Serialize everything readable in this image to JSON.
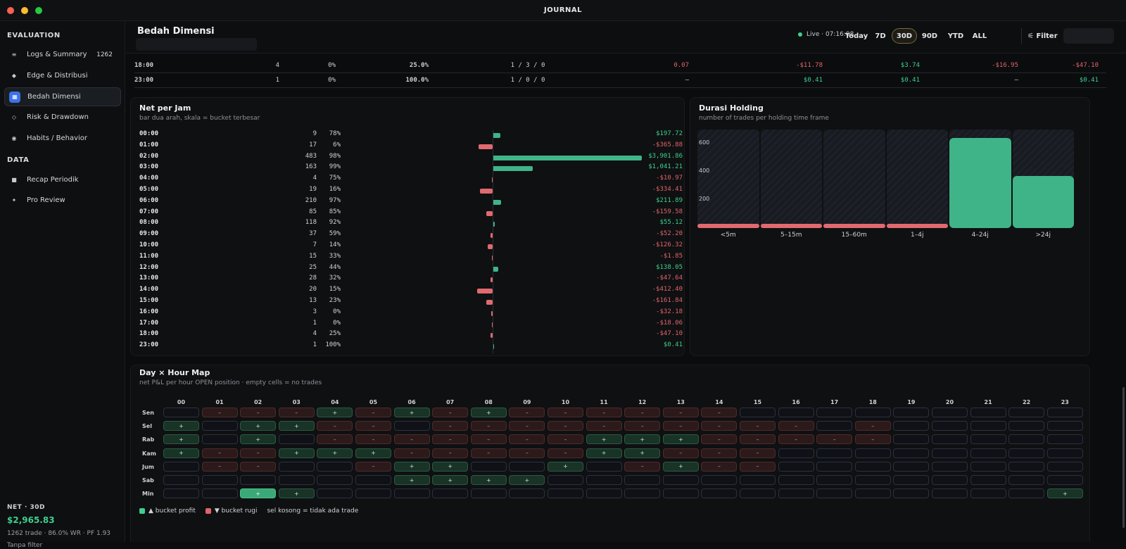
{
  "app": {
    "title": "JOURNAL"
  },
  "sidebar": {
    "sections": [
      {
        "title": "EVALUATION",
        "items": [
          {
            "label": "Logs & Summary",
            "badge": "1262",
            "icon": "list-icon",
            "glyph": "≡"
          },
          {
            "label": "Edge & Distribusi",
            "icon": "diamond-icon",
            "glyph": "◆"
          },
          {
            "label": "Bedah Dimensi",
            "icon": "grid-icon",
            "glyph": "▦",
            "active": true
          },
          {
            "label": "Risk & Drawdown",
            "icon": "circle-icon",
            "glyph": "◇"
          },
          {
            "label": "Habits / Behavior",
            "icon": "dot-icon",
            "glyph": "◉"
          }
        ]
      },
      {
        "title": "DATA",
        "items": [
          {
            "label": "Recap Periodik",
            "icon": "square-icon",
            "glyph": "■"
          },
          {
            "label": "Pro Review",
            "icon": "star-icon",
            "glyph": "✦"
          }
        ]
      }
    ],
    "footer": {
      "label": "NET · 30D",
      "value": "$2,965.83",
      "stats": "1262 trade · 86.0% WR · PF 1.93",
      "filter": "Tanpa filter"
    }
  },
  "header": {
    "title": "Bedah Dimensi",
    "live": "Live · 07:16:08",
    "ranges": [
      "Today",
      "7D",
      "30D",
      "90D",
      "YTD",
      "ALL"
    ],
    "active_range": "30D",
    "filter_label": "⚟ Filter"
  },
  "top_table": {
    "rows": [
      [
        "18:00",
        "4",
        "0%",
        "25.0%",
        "1 / 3 / 0",
        "0.07",
        "-$11.78",
        "$3.74",
        "-$16.95",
        "-$47.10"
      ],
      [
        "23:00",
        "1",
        "0%",
        "100.0%",
        "1 / 0 / 0",
        "–",
        "$0.41",
        "$0.41",
        "–",
        "$0.41"
      ]
    ]
  },
  "net_per_jam": {
    "title": "Net per Jam",
    "subtitle": "bar dua arah, skala = bucket terbesar",
    "rows": [
      {
        "hour": "00:00",
        "count": "9",
        "wr": "78%",
        "value": 197.72,
        "label": "$197.72"
      },
      {
        "hour": "01:00",
        "count": "17",
        "wr": "6%",
        "value": -365.88,
        "label": "-$365.88"
      },
      {
        "hour": "02:00",
        "count": "483",
        "wr": "98%",
        "value": 3901.86,
        "label": "$3,901.86"
      },
      {
        "hour": "03:00",
        "count": "163",
        "wr": "99%",
        "value": 1041.21,
        "label": "$1,041.21"
      },
      {
        "hour": "04:00",
        "count": "4",
        "wr": "75%",
        "value": -10.97,
        "label": "-$10.97"
      },
      {
        "hour": "05:00",
        "count": "19",
        "wr": "16%",
        "value": -334.41,
        "label": "-$334.41"
      },
      {
        "hour": "06:00",
        "count": "210",
        "wr": "97%",
        "value": 211.89,
        "label": "$211.89"
      },
      {
        "hour": "07:00",
        "count": "85",
        "wr": "85%",
        "value": -159.58,
        "label": "-$159.58"
      },
      {
        "hour": "08:00",
        "count": "118",
        "wr": "92%",
        "value": 55.12,
        "label": "$55.12"
      },
      {
        "hour": "09:00",
        "count": "37",
        "wr": "59%",
        "value": -52.2,
        "label": "-$52.20"
      },
      {
        "hour": "10:00",
        "count": "7",
        "wr": "14%",
        "value": -126.32,
        "label": "-$126.32"
      },
      {
        "hour": "11:00",
        "count": "15",
        "wr": "33%",
        "value": -1.85,
        "label": "-$1.85"
      },
      {
        "hour": "12:00",
        "count": "25",
        "wr": "44%",
        "value": 138.05,
        "label": "$138.05"
      },
      {
        "hour": "13:00",
        "count": "28",
        "wr": "32%",
        "value": -47.64,
        "label": "-$47.64"
      },
      {
        "hour": "14:00",
        "count": "20",
        "wr": "15%",
        "value": -412.4,
        "label": "-$412.40"
      },
      {
        "hour": "15:00",
        "count": "13",
        "wr": "23%",
        "value": -161.84,
        "label": "-$161.84"
      },
      {
        "hour": "16:00",
        "count": "3",
        "wr": "0%",
        "value": -32.18,
        "label": "-$32.18"
      },
      {
        "hour": "17:00",
        "count": "1",
        "wr": "0%",
        "value": -18.06,
        "label": "-$18.06"
      },
      {
        "hour": "18:00",
        "count": "4",
        "wr": "25%",
        "value": -47.1,
        "label": "-$47.10"
      },
      {
        "hour": "23:00",
        "count": "1",
        "wr": "100%",
        "value": 0.41,
        "label": "$0.41"
      }
    ]
  },
  "chart_data": {
    "type": "bar",
    "title": "Durasi Holding",
    "subtitle": "number of trades per holding time frame",
    "categories": [
      "<5m",
      "5–15m",
      "15–60m",
      "1–4j",
      ">24j"
    ],
    "values": [],
    "ylim": [
      0,
      700
    ],
    "yticks": [
      "600",
      "400",
      "200"
    ],
    "colors": {
      "loss": "#e06a6f",
      "profit": "#3fb488"
    }
  },
  "durasi_categories": [
    "<5m",
    "5–15m",
    "15–60m",
    "1–4j",
    "4–24j",
    ">24j"
  ],
  "durasi_values": [
    8,
    5,
    15,
    20,
    640,
    370
  ],
  "durasi_kinds": [
    "loss",
    "loss",
    "loss",
    "loss",
    "profit",
    "profit"
  ],
  "day_hour": {
    "title": "Day × Hour Map",
    "subtitle": "net P&L per hour OPEN position · empty cells = no trades",
    "hours": [
      "00",
      "01",
      "02",
      "03",
      "04",
      "05",
      "06",
      "07",
      "08",
      "09",
      "10",
      "11",
      "12",
      "13",
      "14",
      "15",
      "16",
      "17",
      "18",
      "19",
      "20",
      "21",
      "22",
      "23"
    ],
    "days": [
      {
        "name": "Sen",
        "cells": [
          "",
          "n",
          "n",
          "n",
          "p",
          "n",
          "p",
          "n",
          "p",
          "n",
          "n",
          "n",
          "n",
          "n",
          "n",
          "",
          "",
          "",
          "",
          "",
          "",
          "",
          "",
          ""
        ]
      },
      {
        "name": "Sel",
        "cells": [
          "p",
          "",
          "p",
          "p",
          "n",
          "n",
          "",
          "n",
          "n",
          "n",
          "n",
          "n",
          "n",
          "n",
          "n",
          "n",
          "n",
          "",
          "n",
          "",
          "",
          "",
          "",
          ""
        ]
      },
      {
        "name": "Rab",
        "cells": [
          "p",
          "",
          "p",
          "",
          "n",
          "n",
          "n",
          "n",
          "n",
          "n",
          "n",
          "p",
          "p",
          "p",
          "n",
          "n",
          "n",
          "n",
          "n",
          "",
          "",
          "",
          "",
          ""
        ]
      },
      {
        "name": "Kam",
        "cells": [
          "p",
          "n",
          "n",
          "p",
          "p",
          "p",
          "n",
          "n",
          "n",
          "n",
          "n",
          "p",
          "p",
          "n",
          "n",
          "n",
          "",
          "",
          "",
          "",
          "",
          "",
          "",
          ""
        ]
      },
      {
        "name": "Jum",
        "cells": [
          "",
          "n",
          "n",
          "",
          "",
          "n",
          "p",
          "p",
          "",
          "",
          "p",
          "",
          "n",
          "p",
          "n",
          "n",
          "",
          "",
          "",
          "",
          "",
          "",
          "",
          ""
        ]
      },
      {
        "name": "Sab",
        "cells": [
          "",
          "",
          "",
          "",
          "",
          "",
          "p",
          "p",
          "p",
          "p",
          "",
          "",
          "",
          "",
          "",
          "",
          "",
          "",
          "",
          "",
          "",
          "",
          "",
          ""
        ]
      },
      {
        "name": "Min",
        "cells": [
          "",
          "",
          "pp",
          "p",
          "",
          "",
          "",
          "",
          "",
          "",
          "",
          "",
          "",
          "",
          "",
          "",
          "",
          "",
          "",
          "",
          "",
          "",
          "",
          "p"
        ]
      }
    ],
    "legend": {
      "profit": "▲ bucket profit",
      "loss": "▼ bucket rugi",
      "empty": "sel kosong = tidak ada trade"
    }
  },
  "colors": {
    "pos": "#3ecf8e",
    "neg": "#e0646a",
    "accent": "#3b73e8"
  }
}
